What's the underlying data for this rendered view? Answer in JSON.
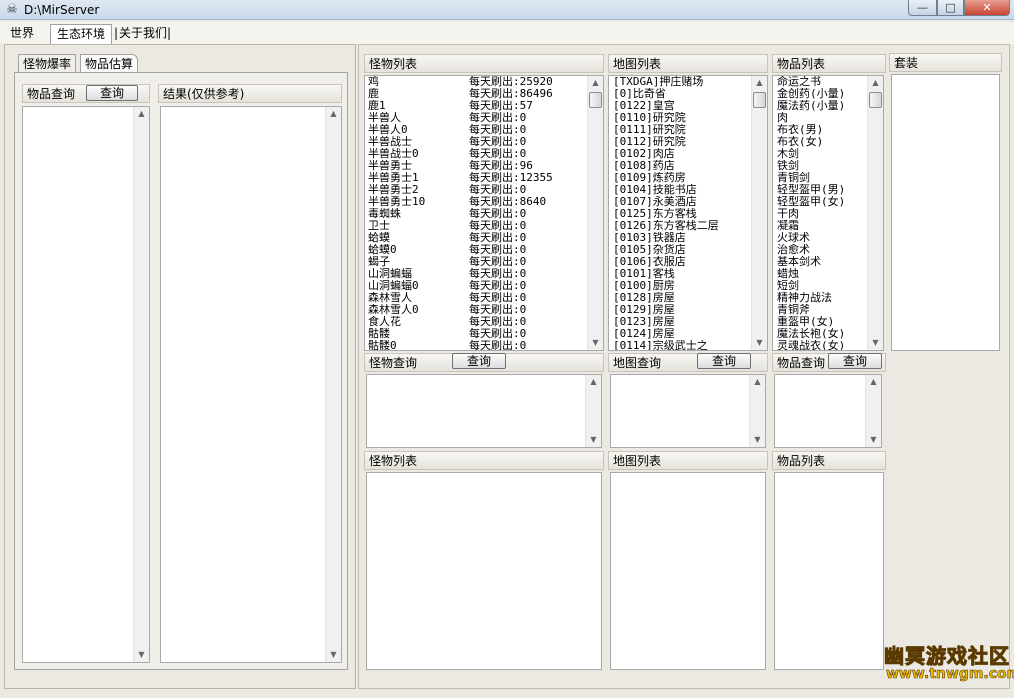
{
  "window": {
    "title": "D:\\MirServer",
    "min_glyph": "—",
    "max_glyph": "□",
    "close_glyph": "✕"
  },
  "menu": {
    "tabs": [
      "世界",
      "生态环境",
      "关于我们"
    ],
    "separator": "|"
  },
  "left": {
    "subtabs": [
      "怪物爆率",
      "物品估算"
    ],
    "item_query_label": "物品查询",
    "query_button": "查询",
    "result_label": "结果(仅供参考)"
  },
  "monster_list": {
    "label": "怪物列表",
    "rows": [
      {
        "name": "鸡",
        "rate": "每天刷出:25920"
      },
      {
        "name": "鹿",
        "rate": "每天刷出:86496"
      },
      {
        "name": "鹿1",
        "rate": "每天刷出:57"
      },
      {
        "name": "半兽人",
        "rate": "每天刷出:0"
      },
      {
        "name": "半兽人0",
        "rate": "每天刷出:0"
      },
      {
        "name": "半兽战士",
        "rate": "每天刷出:0"
      },
      {
        "name": "半兽战士0",
        "rate": "每天刷出:0"
      },
      {
        "name": "半兽勇士",
        "rate": "每天刷出:96"
      },
      {
        "name": "半兽勇士1",
        "rate": "每天刷出:12355"
      },
      {
        "name": "半兽勇士2",
        "rate": "每天刷出:0"
      },
      {
        "name": "半兽勇士10",
        "rate": "每天刷出:8640"
      },
      {
        "name": "毒蜘蛛",
        "rate": "每天刷出:0"
      },
      {
        "name": "卫士",
        "rate": "每天刷出:0"
      },
      {
        "name": "蛤蟆",
        "rate": "每天刷出:0"
      },
      {
        "name": "蛤蟆0",
        "rate": "每天刷出:0"
      },
      {
        "name": "蝎子",
        "rate": "每天刷出:0"
      },
      {
        "name": "山洞蝙蝠",
        "rate": "每天刷出:0"
      },
      {
        "name": "山洞蝙蝠0",
        "rate": "每天刷出:0"
      },
      {
        "name": "森林雪人",
        "rate": "每天刷出:0"
      },
      {
        "name": "森林雪人0",
        "rate": "每天刷出:0"
      },
      {
        "name": "食人花",
        "rate": "每天刷出:0"
      },
      {
        "name": "骷髅",
        "rate": "每天刷出:0"
      },
      {
        "name": "骷髅0",
        "rate": "每天刷出:0"
      }
    ]
  },
  "map_list": {
    "label": "地图列表",
    "rows": [
      "[TXDGA]押庄赌场",
      "[0]比奇省",
      "[0122]皇宫",
      "[0110]研究院",
      "[0111]研究院",
      "[0112]研究院",
      "[0102]肉店",
      "[0108]药店",
      "[0109]炼药房",
      "[0104]技能书店",
      "[0107]永美酒店",
      "[0125]东方客栈",
      "[0126]东方客栈二层",
      "[0103]铁器店",
      "[0105]杂货店",
      "[0106]衣服店",
      "[0101]客栈",
      "[0100]厨房",
      "[0128]房屋",
      "[0129]房屋",
      "[0123]房屋",
      "[0124]房屋",
      "[0114]宗级武士之"
    ]
  },
  "item_list": {
    "label": "物品列表",
    "rows": [
      "命运之书",
      "金创药(小量)",
      "魔法药(小量)",
      "肉",
      "布衣(男)",
      "布衣(女)",
      "木剑",
      "铁剑",
      "青铜剑",
      "轻型盔甲(男)",
      "轻型盔甲(女)",
      "干肉",
      "凝霜",
      "火球术",
      "治愈术",
      "基本剑术",
      "蜡烛",
      "短剑",
      "精神力战法",
      "青铜斧",
      "重盔甲(女)",
      "魔法长袍(女)",
      "灵魂战衣(女)"
    ]
  },
  "set_panel": {
    "label": "套装"
  },
  "queries": {
    "monster_query": "怪物查询",
    "map_query": "地图查询",
    "item_query": "物品查询",
    "button": "查询"
  },
  "bottom_labels": {
    "monster": "怪物列表",
    "map": "地图列表",
    "item": "物品列表"
  },
  "watermark": {
    "line1": "幽冥游戏社区",
    "line2": "www.tnwgm.com"
  }
}
